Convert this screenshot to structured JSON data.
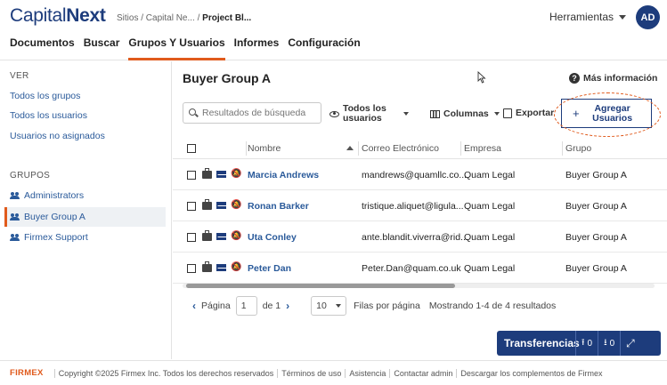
{
  "header": {
    "logo_light": "Capital",
    "logo_bold": "Next",
    "breadcrumb_parent": "Sitios / Capital Ne... /",
    "breadcrumb_current": "Project Bl...",
    "tools_label": "Herramientas",
    "avatar_initials": "AD"
  },
  "nav": {
    "tabs": [
      "Documentos",
      "Buscar",
      "Grupos Y Usuarios",
      "Informes",
      "Configuración"
    ],
    "active_tab": "Grupos Y Usuarios"
  },
  "sidebar": {
    "view_title": "VER",
    "view_links": [
      "Todos los grupos",
      "Todos los usuarios",
      "Usuarios no asignados"
    ],
    "groups_title": "GRUPOS",
    "groups": [
      "Administrators",
      "Buyer Group A",
      "Firmex Support"
    ],
    "active_group": "Buyer Group A"
  },
  "main": {
    "title": "Buyer Group A",
    "more_info": "Más información",
    "search_placeholder": "Resultados de búsqueda",
    "view_selector": "Todos los usuarios",
    "columns_label": "Columnas",
    "export_label": "Exportar",
    "add_users_label": "Agregar Usuarios"
  },
  "table": {
    "headers": [
      "Nombre",
      "Correo Electrónico",
      "Empresa",
      "Grupo"
    ],
    "rows": [
      {
        "name": "Marcia Andrews",
        "email": "mandrews@quamllc.co...",
        "company": "Quam Legal",
        "group": "Buyer Group A"
      },
      {
        "name": "Ronan Barker",
        "email": "tristique.aliquet@ligula...",
        "company": "Quam Legal",
        "group": "Buyer Group A"
      },
      {
        "name": "Uta Conley",
        "email": "ante.blandit.viverra@rid...",
        "company": "Quam Legal",
        "group": "Buyer Group A"
      },
      {
        "name": "Peter Dan",
        "email": "Peter.Dan@quam.co.uk",
        "company": "Quam Legal",
        "group": "Buyer Group A"
      }
    ]
  },
  "pagination": {
    "page_label": "Página",
    "page_value": "1",
    "of_label": "de 1",
    "page_size": "10",
    "per_page_label": "Filas por página",
    "results_label": "Mostrando 1-4 de 4 resultados"
  },
  "transfers": {
    "label": "Transferencias",
    "uploads": "0",
    "downloads": "0"
  },
  "footer": {
    "brand": "FIRMEX",
    "copyright": "Copyright ©2025 Firmex Inc. Todos los derechos reservados",
    "links": [
      "Términos de uso",
      "Asistencia",
      "Contactar admin",
      "Descargar los complementos de Firmex"
    ]
  },
  "colors": {
    "brand_navy": "#1d3c7c",
    "accent_orange": "#e05a1c",
    "link_blue": "#2a5a9a"
  }
}
